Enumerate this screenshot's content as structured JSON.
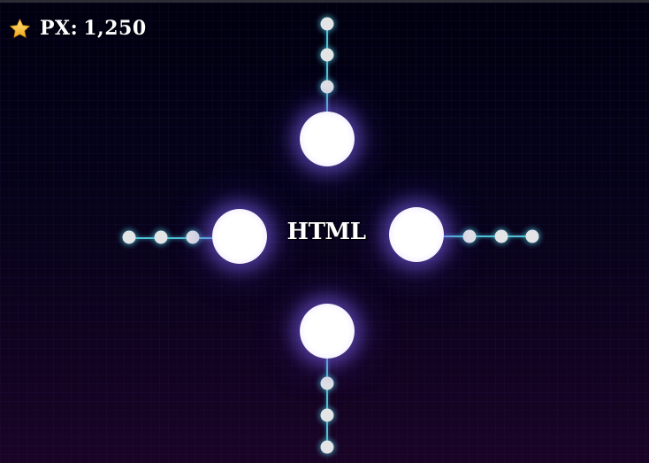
{
  "hud": {
    "currency_icon": "star-icon",
    "currency_label": "PX:",
    "currency_value": "1,250"
  },
  "center": {
    "label": "HTML"
  },
  "colors": {
    "background": "#06031a",
    "node": "#ffffff",
    "node_glow": "#8c6eff",
    "connector": "#4fc3d9",
    "dot": "#e2e4e6",
    "star": "#f5c242"
  },
  "branches": [
    {
      "name": "top",
      "dot_count": 3
    },
    {
      "name": "left",
      "dot_count": 3
    },
    {
      "name": "right",
      "dot_count": 3
    },
    {
      "name": "bottom",
      "dot_count": 3
    }
  ]
}
